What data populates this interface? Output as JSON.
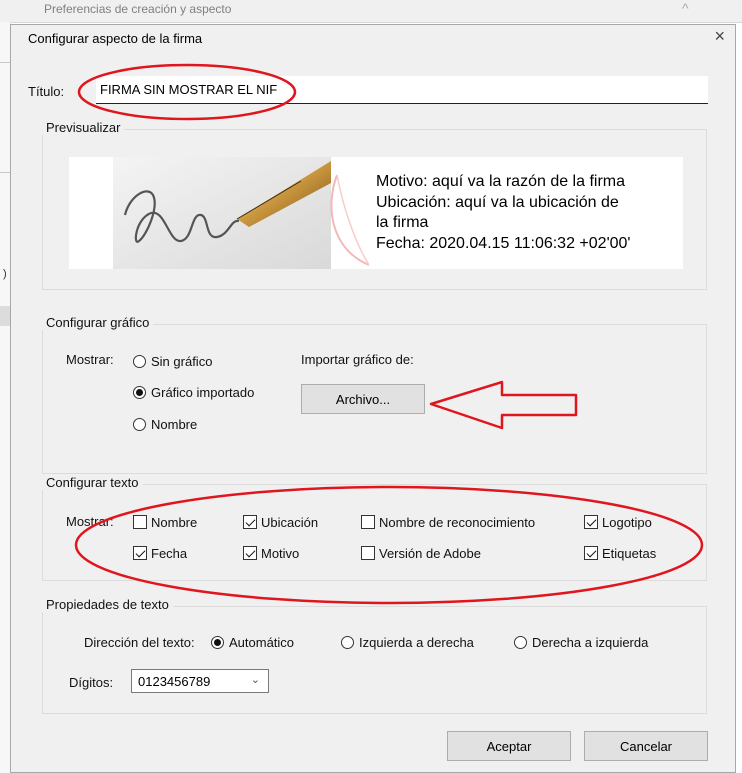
{
  "background_window": {
    "title": "Preferencias de creación y aspecto",
    "chevron": "^",
    "edge_text": ")"
  },
  "dialog": {
    "title": "Configurar aspecto de la firma",
    "close_symbol": "×",
    "title_label": "Título:",
    "title_value": "FIRMA SIN MOSTRAR EL NIF"
  },
  "preview": {
    "group_label": "Previsualizar",
    "lines": [
      "Motivo: aquí va la razón de la firma",
      "Ubicación: aquí va la ubicación de",
      "la firma",
      "Fecha: 2020.04.15 11:06:32 +02'00'"
    ]
  },
  "graphic": {
    "group_label": "Configurar gráfico",
    "show_label": "Mostrar:",
    "options": [
      {
        "label": "Sin gráfico",
        "selected": false
      },
      {
        "label": "Gráfico importado",
        "selected": true
      },
      {
        "label": "Nombre",
        "selected": false
      }
    ],
    "import_label": "Importar gráfico de:",
    "file_button": "Archivo..."
  },
  "text": {
    "group_label": "Configurar texto",
    "show_label": "Mostrar:",
    "checkboxes": [
      {
        "label": "Nombre",
        "checked": false
      },
      {
        "label": "Ubicación",
        "checked": true
      },
      {
        "label": "Nombre de reconocimiento",
        "checked": false
      },
      {
        "label": "Logotipo",
        "checked": true
      },
      {
        "label": "Fecha",
        "checked": true
      },
      {
        "label": "Motivo",
        "checked": true
      },
      {
        "label": "Versión de Adobe",
        "checked": false
      },
      {
        "label": "Etiquetas",
        "checked": true
      }
    ]
  },
  "properties": {
    "group_label": "Propiedades de texto",
    "direction_label": "Dirección del texto:",
    "directions": [
      {
        "label": "Automático",
        "selected": true
      },
      {
        "label": "Izquierda a derecha",
        "selected": false
      },
      {
        "label": "Derecha a izquierda",
        "selected": false
      }
    ],
    "digits_label": "Dígitos:",
    "digits_value": "0123456789"
  },
  "buttons": {
    "accept": "Aceptar",
    "cancel": "Cancelar"
  },
  "colors": {
    "annotation_red": "#e0161e",
    "dialog_bg": "#f0f0f0",
    "button_bg": "#e1e1e1"
  }
}
